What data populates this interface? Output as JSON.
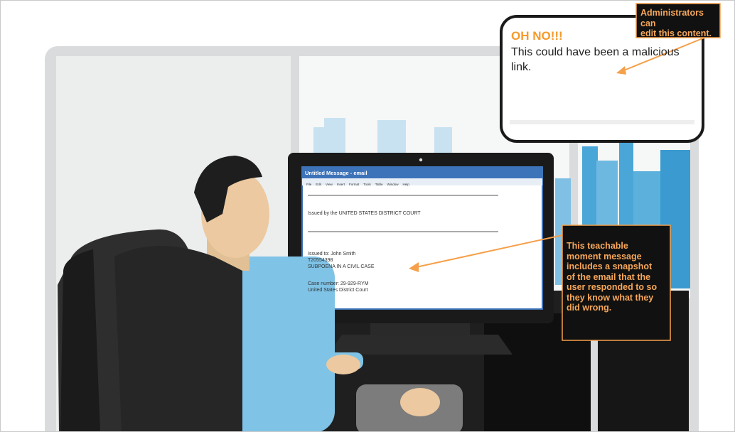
{
  "bubble": {
    "title": "OH NO!!!",
    "body": "This could have been a malicious link."
  },
  "admin_callout": {
    "text_lines": [
      "Administrators can",
      "edit this content."
    ]
  },
  "teach_callout": {
    "text_lines": [
      "This teachable",
      "moment message",
      "includes a snapshot",
      "of the email that the",
      "user responded to so",
      "they know what they",
      "did wrong."
    ]
  },
  "email": {
    "window_title": "Untitled Message - email",
    "menu": [
      "File",
      "Edit",
      "View",
      "Insert",
      "Format",
      "Tools",
      "Table",
      "Window",
      "Help"
    ],
    "issued_by": "Issued by the UNITED STATES DISTRICT COURT",
    "issued_to": "Issued to: John Smith",
    "ref_number": "T20554398",
    "subject": "SUBPOENA IN A CIVIL CASE",
    "case_number": "Case number: 29-929-RYM",
    "court": "United States District Court"
  },
  "colors": {
    "accent_orange": "#f5a04a",
    "callout_bg": "#111111",
    "window_blue": "#3d73b8",
    "sky_blue": "#4aa6d6"
  }
}
